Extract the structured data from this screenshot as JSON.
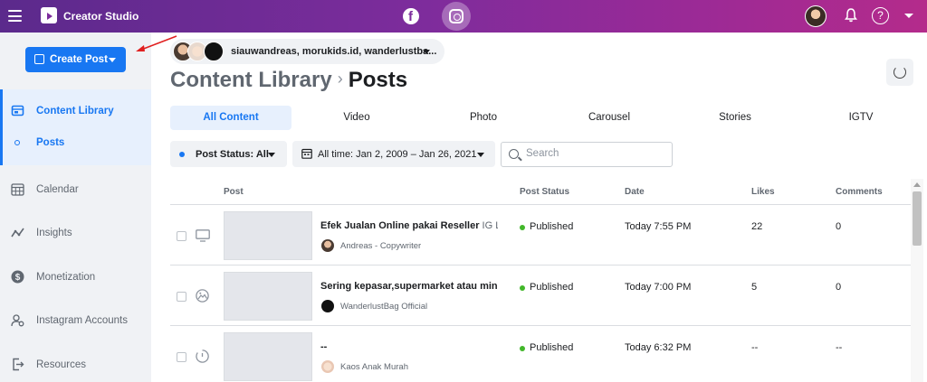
{
  "topbar": {
    "app_title": "Creator Studio",
    "icons": [
      "hamburger-menu-icon",
      "creator-studio-logo-icon",
      "facebook-icon",
      "instagram-icon",
      "profile-avatar",
      "bell-icon",
      "help-icon",
      "caret-down-icon"
    ],
    "help_glyph": "?"
  },
  "sidebar": {
    "create_post_label": "Create Post",
    "items": [
      {
        "label": "Content Library",
        "icon": "content-library-icon",
        "active": true
      },
      {
        "label": "Posts",
        "icon": "dot-icon",
        "active": true
      },
      {
        "label": "Calendar",
        "icon": "calendar-icon",
        "active": false
      },
      {
        "label": "Insights",
        "icon": "insights-icon",
        "active": false
      },
      {
        "label": "Monetization",
        "icon": "dollar-icon",
        "active": false
      },
      {
        "label": "Instagram Accounts",
        "icon": "accounts-gear-icon",
        "active": false
      },
      {
        "label": "Resources",
        "icon": "resources-icon",
        "active": false
      }
    ]
  },
  "header": {
    "accounts": "siauwandreas, morukids.id, wanderlustba...",
    "breadcrumb": {
      "parent": "Content Library",
      "separator": "›",
      "current": "Posts"
    }
  },
  "tabs": [
    "All Content",
    "Video",
    "Photo",
    "Carousel",
    "Stories",
    "IGTV"
  ],
  "active_tab": "All Content",
  "filters": {
    "post_status": "Post Status: All",
    "date_range": "All time: Jan 2, 2009 – Jan 26, 2021",
    "search_placeholder": "Search"
  },
  "table": {
    "headers": {
      "post": "Post",
      "status": "Post Status",
      "date": "Date",
      "likes": "Likes",
      "comments": "Comments"
    },
    "rows": [
      {
        "caption": "Efek Jualan Online pakai Reseller",
        "caption_extra": " IG Liv...",
        "author": "Andreas - Copywriter",
        "type_icon": "monitor-icon",
        "status": "Published",
        "date": "Today 7:55 PM",
        "likes": "22",
        "comments": "0"
      },
      {
        "caption": "Sering kepasar,supermarket atau mini...",
        "caption_extra": "",
        "author": "WanderlustBag Official",
        "type_icon": "photo-icon",
        "status": "Published",
        "date": "Today 7:00 PM",
        "likes": "5",
        "comments": "0"
      },
      {
        "caption": "--",
        "caption_extra": "",
        "author": "Kaos Anak Murah",
        "type_icon": "stories-icon",
        "status": "Published",
        "date": "Today 6:32 PM",
        "likes": "--",
        "comments": "--"
      }
    ]
  },
  "colors": {
    "brand_blue": "#1877f2",
    "published_green": "#42b72a",
    "topbar_start": "#5b2a8c",
    "topbar_end": "#b42b8b"
  }
}
